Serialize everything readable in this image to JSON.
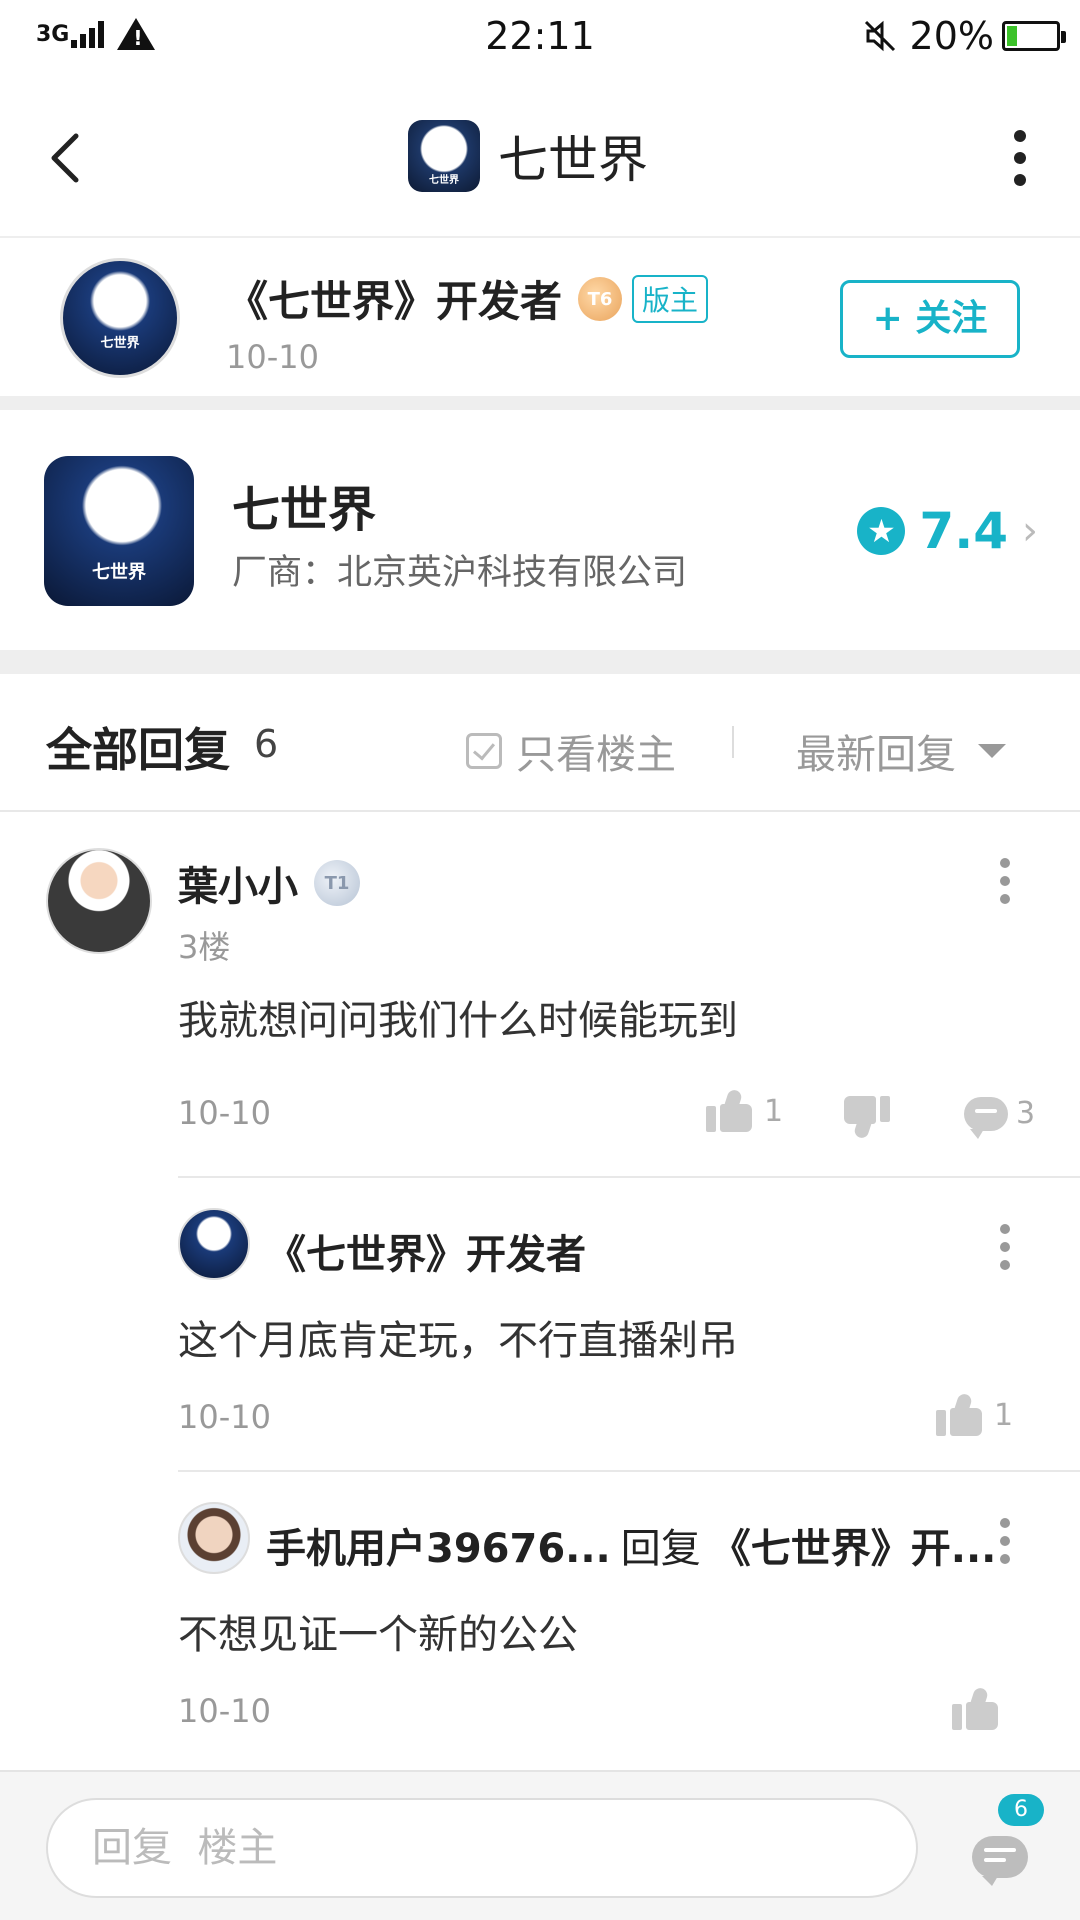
{
  "status_bar": {
    "network": "3G",
    "time": "22:11",
    "battery_percent_text": "20%",
    "battery_level": 0.2,
    "battery_color": "#3cc22a"
  },
  "nav": {
    "title": "七世界",
    "back_icon": "chevron-left-icon",
    "more_icon": "more-vertical-icon"
  },
  "app_icon_text": "Seven-Worlds 七世界",
  "author": {
    "name": "《七世界》开发者",
    "level_badge": "T6",
    "role_badge": "版主",
    "date": "10-10",
    "follow_label": "+ 关注"
  },
  "game": {
    "name": "七世界",
    "vendor": "厂商：北京英沪科技有限公司",
    "rating": "7.4"
  },
  "replies_header": {
    "title": "全部回复",
    "count": "6",
    "only_owner_label": "只看楼主",
    "sort_label": "最新回复"
  },
  "comments": [
    {
      "name": "葉小小",
      "level_badge": "T1",
      "floor": "3楼",
      "text": "我就想问问我们什么时候能玩到",
      "date": "10-10",
      "likes": "1",
      "replies": "3"
    },
    {
      "name": "《七世界》开发者",
      "text": "这个月底肯定玩，不行直播剁吊",
      "date": "10-10",
      "likes": "1"
    },
    {
      "name": "手机用户39676...",
      "reply_word": "回复",
      "reply_to": "《七世界》开...",
      "text": "不想见证一个新的公公",
      "date": "10-10"
    }
  ],
  "bottom_bar": {
    "input_placeholder": "回复  楼主",
    "comment_badge": "6"
  },
  "colors": {
    "accent": "#18b3c8",
    "divider": "#eeeeee"
  }
}
